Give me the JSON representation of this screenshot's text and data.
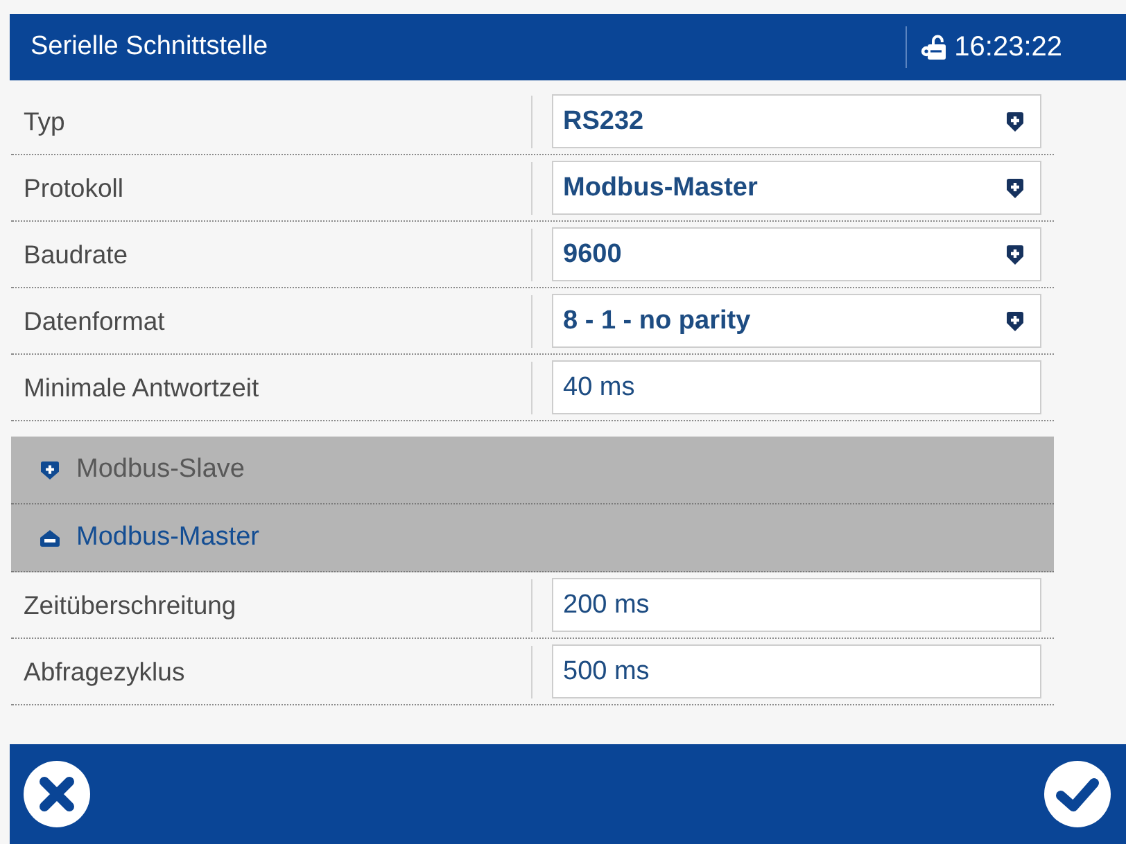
{
  "header": {
    "title": "Serielle Schnittstelle",
    "time": "16:23:22"
  },
  "settings": [
    {
      "kind": "dropdown",
      "label": "Typ",
      "value": "RS232"
    },
    {
      "kind": "dropdown",
      "label": "Protokoll",
      "value": "Modbus-Master"
    },
    {
      "kind": "dropdown",
      "label": "Baudrate",
      "value": "9600"
    },
    {
      "kind": "dropdown",
      "label": "Datenformat",
      "value": "8 - 1 - no parity"
    },
    {
      "kind": "input",
      "label": "Minimale Antwortzeit",
      "value": "40 ms"
    }
  ],
  "sections": [
    {
      "title": "Modbus-Slave",
      "expanded": false
    },
    {
      "title": "Modbus-Master",
      "expanded": true,
      "rows": [
        {
          "kind": "input",
          "label": "Zeitüberschreitung",
          "value": "200 ms"
        },
        {
          "kind": "input",
          "label": "Abfragezyklus",
          "value": "500 ms"
        }
      ]
    }
  ],
  "footer": {
    "buttons": [
      {
        "kind": "cancel"
      },
      {
        "kind": "confirm"
      }
    ]
  }
}
